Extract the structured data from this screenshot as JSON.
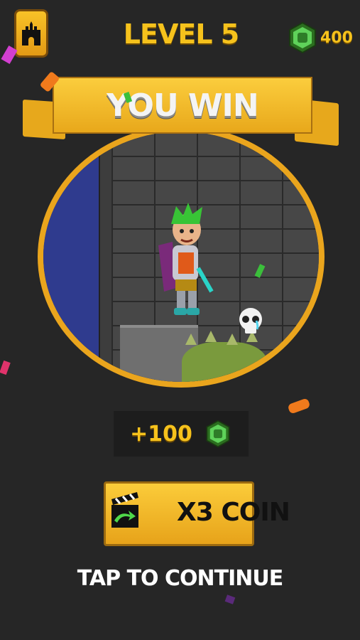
{
  "header": {
    "level_title": "LEVEL 5",
    "coin_total": "400",
    "home_icon": "castle-icon"
  },
  "banner": {
    "title": "YOU WIN"
  },
  "reward": {
    "amount": "+100",
    "coin_icon": "gem-coin-icon"
  },
  "buttons": {
    "x3_label": "X3 COIN",
    "x3_icon": "video-clapper-icon"
  },
  "footer": {
    "tap_to_continue": "TAP TO CONTINUE"
  },
  "colors": {
    "background": "#262626",
    "gold": "#f6c21c",
    "banner": "#f2b82a",
    "coin_green": "#4fc94f",
    "night_sky": "#2f3b8e"
  }
}
